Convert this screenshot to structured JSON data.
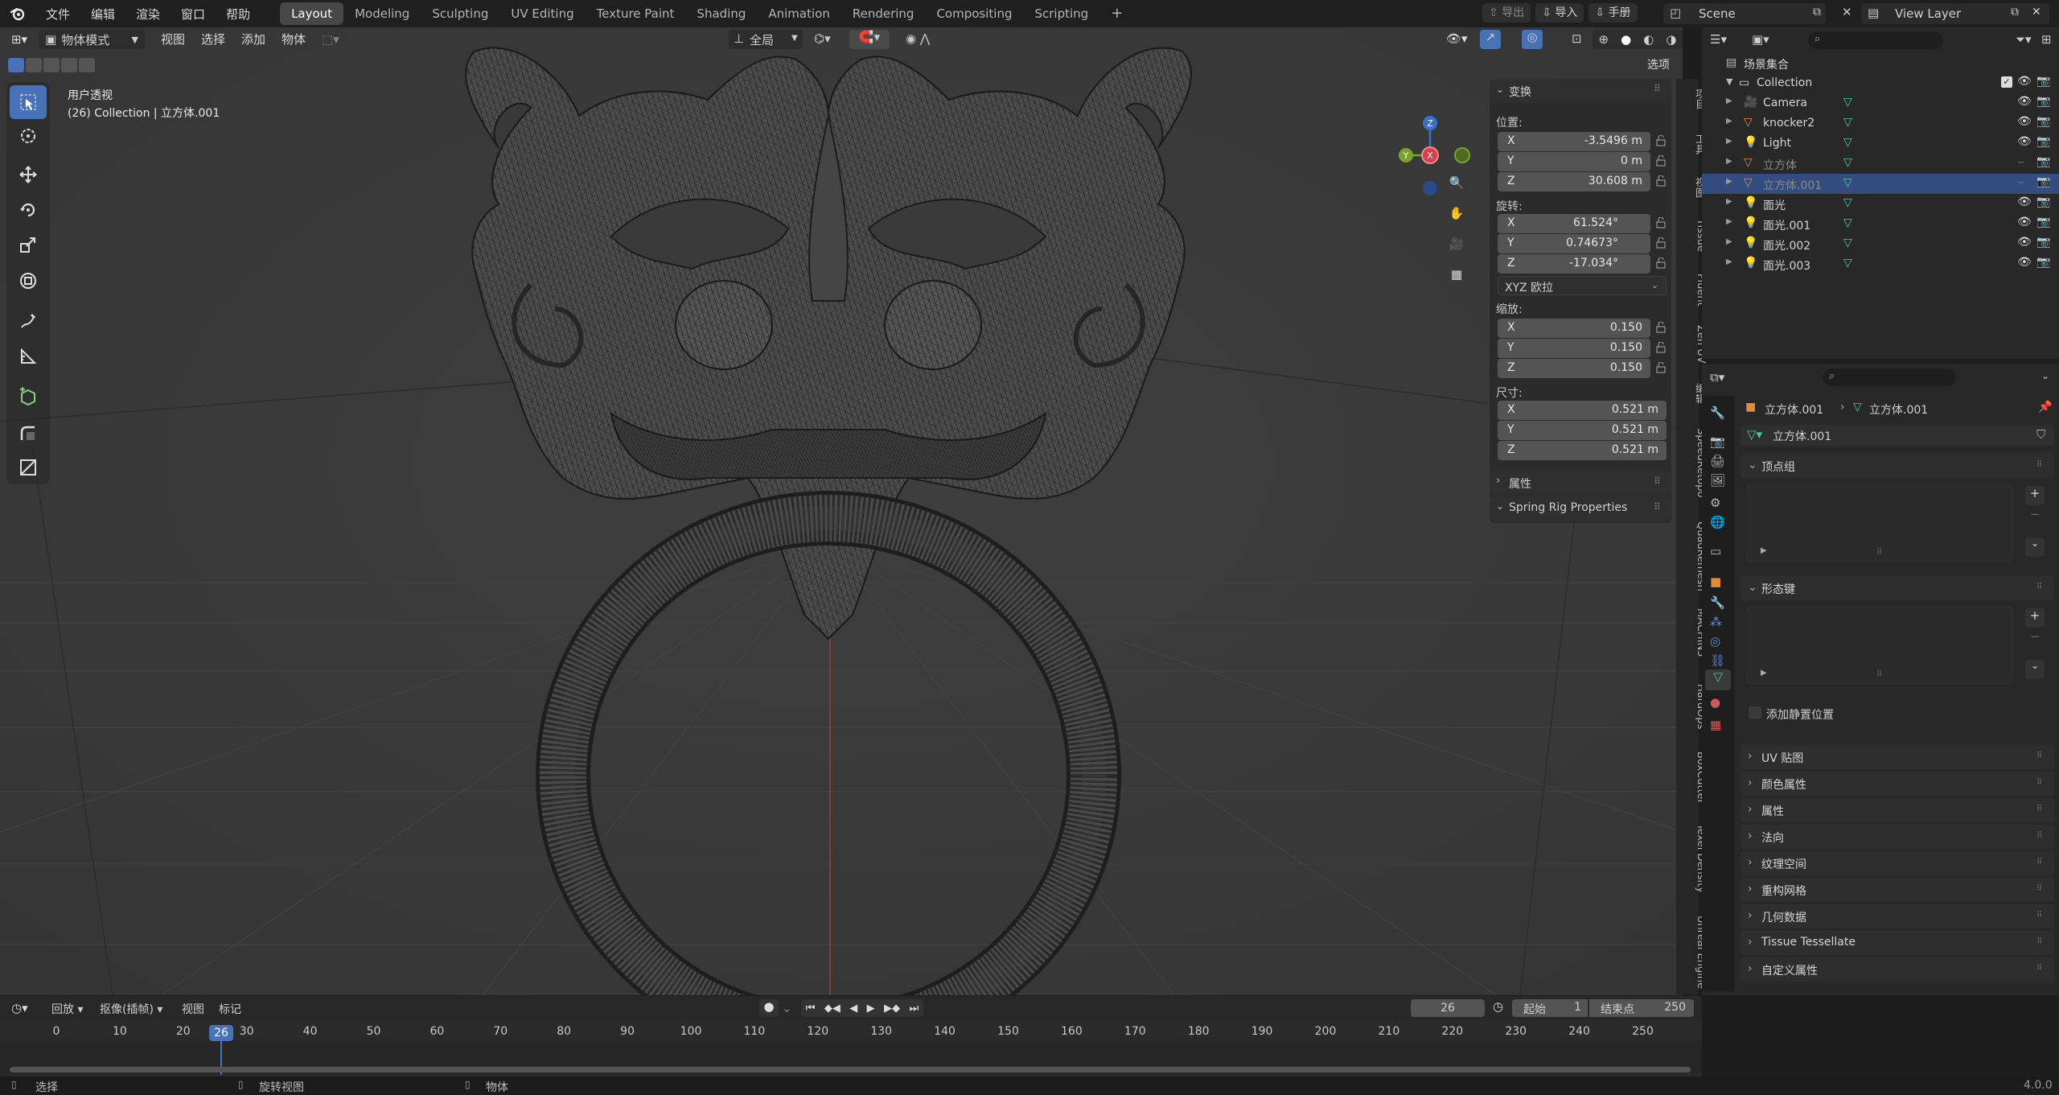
{
  "topbar": {
    "menus": [
      "文件",
      "编辑",
      "渲染",
      "窗口",
      "帮助"
    ],
    "workspaces": [
      "Layout",
      "Modeling",
      "Sculpting",
      "UV Editing",
      "Texture Paint",
      "Shading",
      "Animation",
      "Rendering",
      "Compositing",
      "Scripting"
    ],
    "active_workspace": "Layout",
    "export_label": "导出",
    "import_label": "导入",
    "manual_label": "手册",
    "scene": "Scene",
    "view_layer": "View Layer"
  },
  "viewport": {
    "mode": "物体模式",
    "menus": [
      "视图",
      "选择",
      "添加",
      "物体"
    ],
    "transform_orientation": "全局",
    "options_label": "选项",
    "overlay_title": "用户透视",
    "overlay_sub": "(26) Collection | 立方体.001",
    "gizmo_axes": {
      "x": "X",
      "y": "Y",
      "z": "Z"
    },
    "colors": {
      "x": "#d6404f",
      "y": "#77a22b",
      "z": "#3a6fd0",
      "active_tool": "#4872b8"
    }
  },
  "npanel": {
    "transform_title": "变换",
    "location_label": "位置:",
    "location": [
      {
        "axis": "X",
        "value": "-3.5496 m"
      },
      {
        "axis": "Y",
        "value": "0 m"
      },
      {
        "axis": "Z",
        "value": "30.608 m"
      }
    ],
    "rotation_label": "旋转:",
    "rotation": [
      {
        "axis": "X",
        "value": "61.524°"
      },
      {
        "axis": "Y",
        "value": "0.74673°"
      },
      {
        "axis": "Z",
        "value": "-17.034°"
      }
    ],
    "rotation_mode": "XYZ 欧拉",
    "scale_label": "缩放:",
    "scale": [
      {
        "axis": "X",
        "value": "0.150"
      },
      {
        "axis": "Y",
        "value": "0.150"
      },
      {
        "axis": "Z",
        "value": "0.150"
      }
    ],
    "dimensions_label": "尺寸:",
    "dimensions": [
      {
        "axis": "X",
        "value": "0.521 m"
      },
      {
        "axis": "Y",
        "value": "0.521 m"
      },
      {
        "axis": "Z",
        "value": "0.521 m"
      }
    ],
    "attributes_label": "属性",
    "spring_label": "Spring Rig Properties",
    "side_tabs": [
      "项目",
      "工具",
      "视图",
      "Tissue",
      "Fluent",
      "Zen UV",
      "编辑",
      "SpeedRetopo",
      "QuadRemesh",
      "MACHIN3",
      "HardOps",
      "BoxCutter",
      "Texel Density",
      "Unreal Engine"
    ]
  },
  "outliner": {
    "root": "场景集合",
    "collection": "Collection",
    "items": [
      {
        "name": "Camera",
        "icon": "camera-icon",
        "selected": false,
        "dim": false
      },
      {
        "name": "knocker2",
        "icon": "mesh-icon",
        "selected": false,
        "dim": false
      },
      {
        "name": "Light",
        "icon": "light-icon",
        "selected": false,
        "dim": false
      },
      {
        "name": "立方体",
        "icon": "mesh-icon",
        "selected": false,
        "dim": true
      },
      {
        "name": "立方体.001",
        "icon": "mesh-icon",
        "selected": true,
        "dim": true
      },
      {
        "name": "面光",
        "icon": "light-icon",
        "selected": false,
        "dim": false
      },
      {
        "name": "面光.001",
        "icon": "light-icon",
        "selected": false,
        "dim": false
      },
      {
        "name": "面光.002",
        "icon": "light-icon",
        "selected": false,
        "dim": false
      },
      {
        "name": "面光.003",
        "icon": "light-icon",
        "selected": false,
        "dim": false
      }
    ]
  },
  "properties": {
    "breadcrumb_object": "立方体.001",
    "breadcrumb_data": "立方体.001",
    "data_name": "立方体.001",
    "vertex_groups": "顶点组",
    "shape_keys": "形态键",
    "add_rest_position": "添加静置位置",
    "sections": [
      "UV 贴图",
      "颜色属性",
      "属性",
      "法向",
      "纹理空间",
      "重构网格",
      "几何数据",
      "Tissue Tessellate",
      "自定义属性"
    ]
  },
  "timeline": {
    "playback": "回放",
    "keying": "抠像(插帧)",
    "view": "视图",
    "marker": "标记",
    "current_frame": "26",
    "start_label": "起始",
    "start": "1",
    "end_label": "结束点",
    "end": "250",
    "ticks": [
      "0",
      "10",
      "20",
      "30",
      "40",
      "50",
      "60",
      "70",
      "80",
      "90",
      "100",
      "110",
      "120",
      "130",
      "140",
      "150",
      "160",
      "170",
      "180",
      "190",
      "200",
      "210",
      "220",
      "230",
      "240",
      "250"
    ]
  },
  "statusbar": {
    "select": "选择",
    "rotate": "旋转视图",
    "object": "物体",
    "version": "4.0.0"
  }
}
